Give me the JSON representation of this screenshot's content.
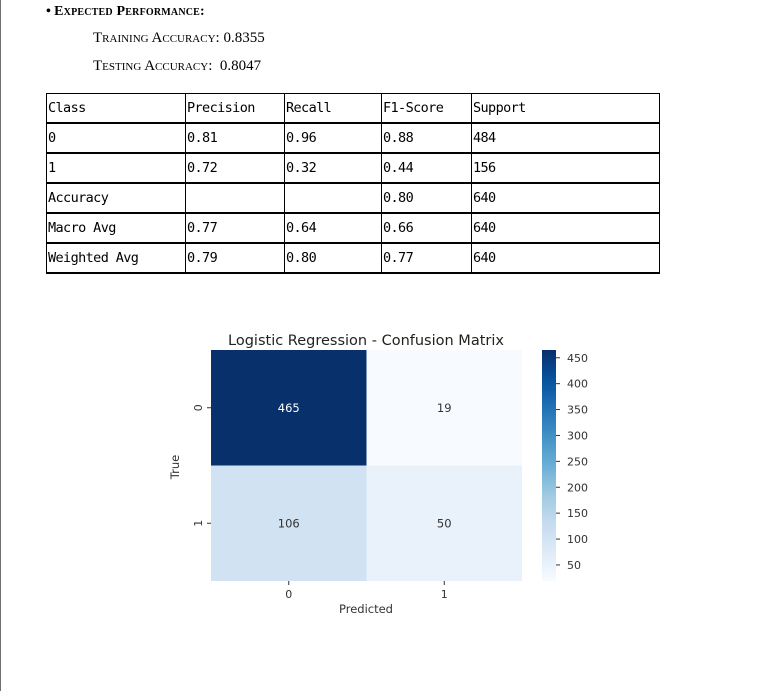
{
  "section": {
    "bullet": "•",
    "heading": "Expected Performance:",
    "training_label": "Training Accuracy:",
    "training_value": "0.8355",
    "testing_label": "Testing Accuracy:",
    "testing_value": "0.8047"
  },
  "report": {
    "headers": [
      "Class",
      "Precision",
      "Recall",
      "F1-Score",
      "Support"
    ],
    "rows": [
      [
        "0",
        "0.81",
        "0.96",
        "0.88",
        "484"
      ],
      [
        "1",
        "0.72",
        "0.32",
        "0.44",
        "156"
      ],
      [
        "Accuracy",
        "",
        "",
        "0.80",
        "640"
      ],
      [
        "Macro Avg",
        "0.77",
        "0.64",
        "0.66",
        "640"
      ],
      [
        "Weighted Avg",
        "0.79",
        "0.80",
        "0.77",
        "640"
      ]
    ]
  },
  "chart_data": {
    "type": "heatmap",
    "title": "Logistic Regression - Confusion Matrix",
    "xlabel": "Predicted",
    "ylabel": "True",
    "x_categories": [
      "0",
      "1"
    ],
    "y_categories": [
      "0",
      "1"
    ],
    "values": [
      [
        465,
        19
      ],
      [
        106,
        50
      ]
    ],
    "colormap": "Blues",
    "colorbar": {
      "ticks": [
        50,
        100,
        150,
        200,
        250,
        300,
        350,
        400,
        450
      ],
      "range": [
        19,
        465
      ]
    },
    "colors": {
      "low": "#f7fbff",
      "high": "#08306b"
    }
  }
}
